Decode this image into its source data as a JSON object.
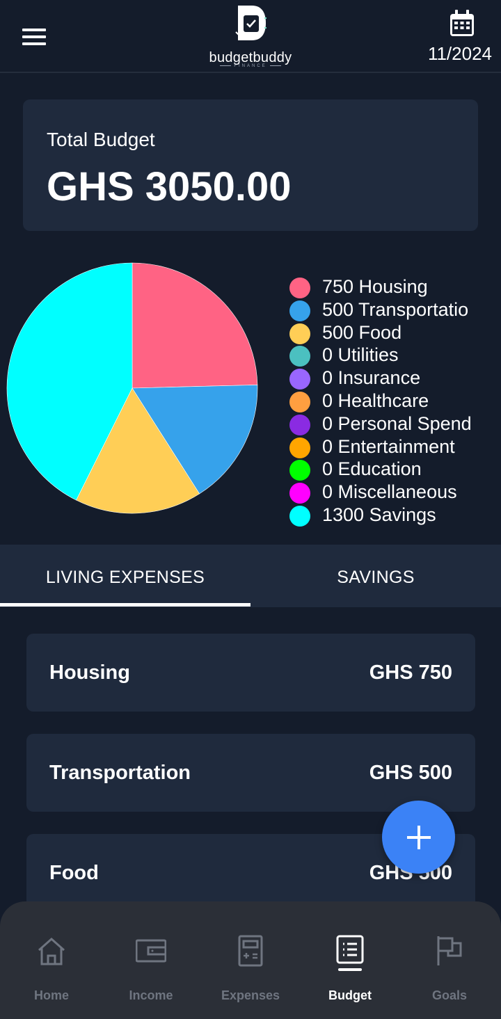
{
  "header": {
    "app_name": "budgetbuddy",
    "tagline": "FINANCE",
    "date": "11/2024"
  },
  "total_budget": {
    "label": "Total Budget",
    "value": "GHS 3050.00"
  },
  "chart_data": {
    "type": "pie",
    "slices": [
      {
        "label": "750 Housing",
        "category": "Housing",
        "value": 750,
        "color": "#ff6384"
      },
      {
        "label": "500 Transportatio",
        "category": "Transportation",
        "value": 500,
        "color": "#36a2eb"
      },
      {
        "label": "500 Food",
        "category": "Food",
        "value": 500,
        "color": "#ffce56"
      },
      {
        "label": "0 Utilities",
        "category": "Utilities",
        "value": 0,
        "color": "#4bc0c0"
      },
      {
        "label": "0 Insurance",
        "category": "Insurance",
        "value": 0,
        "color": "#9966ff"
      },
      {
        "label": "0 Healthcare",
        "category": "Healthcare",
        "value": 0,
        "color": "#ff9f40"
      },
      {
        "label": "0 Personal Spend",
        "category": "Personal Spending",
        "value": 0,
        "color": "#8a2be2"
      },
      {
        "label": "0 Entertainment",
        "category": "Entertainment",
        "value": 0,
        "color": "#ffa500"
      },
      {
        "label": "0 Education",
        "category": "Education",
        "value": 0,
        "color": "#00ff00"
      },
      {
        "label": "0 Miscellaneous",
        "category": "Miscellaneous",
        "value": 0,
        "color": "#ff00ff"
      },
      {
        "label": "1300 Savings",
        "category": "Savings",
        "value": 1300,
        "color": "#00ffff"
      }
    ],
    "legend_position": "right"
  },
  "tabs": [
    {
      "label": "LIVING EXPENSES",
      "active": true
    },
    {
      "label": "SAVINGS",
      "active": false
    }
  ],
  "categories": [
    {
      "name": "Housing",
      "amount": "GHS 750"
    },
    {
      "name": "Transportation",
      "amount": "GHS 500"
    },
    {
      "name": "Food",
      "amount": "GHS 500"
    }
  ],
  "fab": {
    "icon": "plus-icon"
  },
  "bottom_nav": [
    {
      "label": "Home",
      "icon": "home-icon",
      "active": false
    },
    {
      "label": "Income",
      "icon": "wallet-icon",
      "active": false
    },
    {
      "label": "Expenses",
      "icon": "calculator-icon",
      "active": false
    },
    {
      "label": "Budget",
      "icon": "list-icon",
      "active": true
    },
    {
      "label": "Goals",
      "icon": "flag-icon",
      "active": false
    }
  ],
  "colors": {
    "background": "#141c2b",
    "card": "#1f2a3d",
    "accent": "#3b82f6",
    "nav_bg": "#2b2f37",
    "nav_inactive": "#6f7580"
  }
}
